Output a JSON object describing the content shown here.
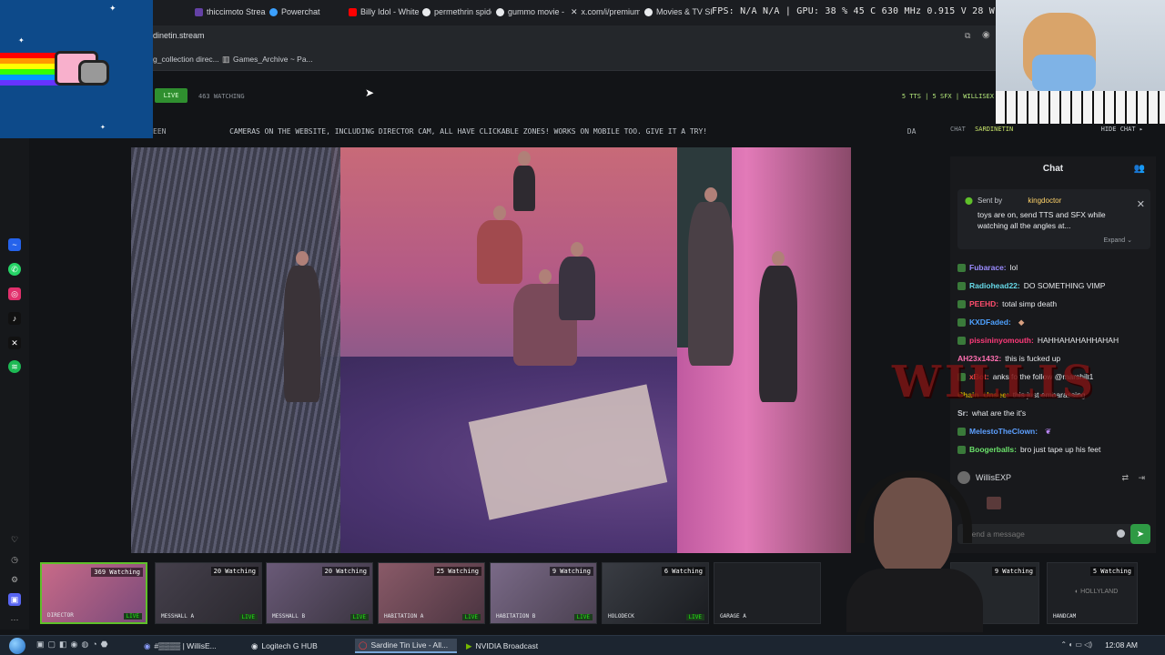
{
  "browser": {
    "tabs": [
      {
        "label": "thiccimoto Strea",
        "color": "#6441a5"
      },
      {
        "label": "Powerchat",
        "color": "#3ba0ff"
      },
      {
        "label": "Billy Idol - White",
        "color": "#ff0000"
      },
      {
        "label": "permethrin spide",
        "color": "#4285f4"
      },
      {
        "label": "gummo movie -",
        "color": "#4285f4"
      },
      {
        "label": "x.com/i/premium",
        "color": "#000000"
      },
      {
        "label": "Movies & TV Sh",
        "color": "#4285f4"
      }
    ],
    "url": "dinetin.stream",
    "bookmarks": [
      "g_collection direc...",
      "Games_Archive ~ Pa..."
    ],
    "perf_overlay": "FPS: N/A  N/A  |  GPU: 38 %  45 C  630 MHz  0.915 V  28 W  1299 RPM"
  },
  "site": {
    "live_label": "LIVE",
    "watching_label": "463 WATCHING",
    "tts_info": "5 TTS | 5 SFX | WILLISEX",
    "ticker_left": "EEN",
    "ticker": "CAMERAS ON THE WEBSITE, INCLUDING DIRECTOR CAM, ALL HAVE CLICKABLE ZONES! WORKS ON MOBILE TOO. GIVE IT A TRY!",
    "ticker_right": "DA"
  },
  "thumbnails": [
    {
      "watching": "369 Watching",
      "label": "DIRECTOR",
      "live": "LIVE",
      "active": true,
      "color": "#b25a78"
    },
    {
      "watching": "20 Watching",
      "label": "MESSHALL A",
      "live": "LIVE",
      "active": false,
      "color": "#3a3640"
    },
    {
      "watching": "20 Watching",
      "label": "MESSHALL B",
      "live": "LIVE",
      "active": false,
      "color": "#5a4a60"
    },
    {
      "watching": "25 Watching",
      "label": "HABITATION A",
      "live": "LIVE",
      "active": false,
      "color": "#7a4a5a"
    },
    {
      "watching": "9 Watching",
      "label": "HABITATION B",
      "live": "LIVE",
      "active": false,
      "color": "#6a5a70"
    },
    {
      "watching": "6 Watching",
      "label": "HOLODECK",
      "live": "LIVE",
      "active": false,
      "color": "#2a2d33"
    },
    {
      "watching": "",
      "label": "GARAGE A",
      "live": "",
      "active": false,
      "color": "#1e2024"
    },
    {
      "watching": "9 Watching",
      "label": "",
      "live": "",
      "active": false,
      "color": "#24272b"
    },
    {
      "watching": "5 Watching",
      "label": "HANDCAM",
      "live": "",
      "active": false,
      "color": "#1e2024"
    }
  ],
  "chat": {
    "header_left": "CHAT",
    "header_user": "SARDINETIN",
    "hide_label": "HIDE CHAT",
    "title": "Chat",
    "pinned": {
      "sent_by": "Sent by",
      "sender": "kingdoctor",
      "text": "toys are on, send TTS and SFX while watching all the angles at...",
      "expand": "Expand"
    },
    "messages": [
      {
        "user": "Fubarace:",
        "text": "lol",
        "color": "#9b8cff"
      },
      {
        "user": "Radiohead22:",
        "text": "DO SOMETHING VIMP",
        "color": "#66d9e8"
      },
      {
        "user": "PEEHD:",
        "text": "total simp death",
        "color": "#ff4d6d"
      },
      {
        "user": "KXDFaded:",
        "text": "",
        "color": "#4ea1ff"
      },
      {
        "user": "pissininyomouth:",
        "text": "HAHHAHAHAHHAHAH",
        "color": "#ff3a7a"
      },
      {
        "user": "AH23x1432:",
        "text": "this is fucked up",
        "color": "#ff6fb0"
      },
      {
        "user": "xBot:",
        "text": "anks fo the follow @marshill1",
        "color": "#ff4444"
      },
      {
        "user": "Chain_Unsee:",
        "text": "this just embarassing",
        "color": "#c7a000"
      },
      {
        "user": "Sr:",
        "text": "what are the it's",
        "color": "#c8ccd2"
      },
      {
        "user": "MelestoTheClown:",
        "text": "",
        "color": "#5da0ff"
      },
      {
        "user": "Boogerballs:",
        "text": "bro just tape up his feet",
        "color": "#6be36b"
      }
    ],
    "current_user": "WillisEXP",
    "input_placeholder": "Send a message"
  },
  "overlay": {
    "willis": "WILLIS"
  },
  "taskbar": {
    "items": [
      {
        "label": "#▒▒▒▒ | WillisE..."
      },
      {
        "label": "Logitech G HUB"
      },
      {
        "label": "Sardine Tin Live - All..."
      },
      {
        "label": "NVIDIA Broadcast"
      }
    ],
    "clock": "12:08 AM"
  }
}
